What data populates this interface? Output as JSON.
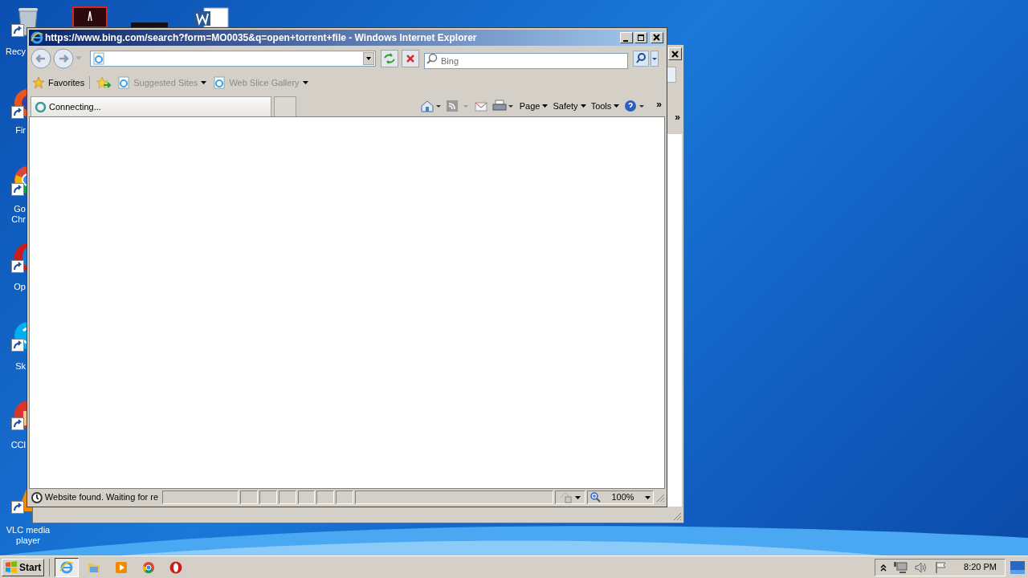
{
  "desktop_icons": [
    {
      "kind": "recycle",
      "lines": [
        "Recy"
      ]
    },
    {
      "kind": "firefox",
      "lines": [
        "Fir"
      ]
    },
    {
      "kind": "chrome",
      "lines": [
        "Go",
        "Chr"
      ]
    },
    {
      "kind": "opera",
      "lines": [
        "Op"
      ]
    },
    {
      "kind": "skype",
      "lines": [
        "Sk"
      ]
    },
    {
      "kind": "ccleaner",
      "lines": [
        "CCl"
      ]
    },
    {
      "kind": "vlc",
      "lines": [
        "VLC media",
        "player"
      ]
    }
  ],
  "back_window": {
    "chevron": "»"
  },
  "ie_window": {
    "title": "https://www.bing.com/search?form=MO0035&q=open+torrent+file - Windows Internet Explorer",
    "search": {
      "placeholder": "Bing"
    },
    "favorites_bar": [
      {
        "kind": "favorites",
        "label": "Favorites"
      },
      {
        "kind": "link",
        "label": "Suggested Sites"
      },
      {
        "kind": "link",
        "label": "Web Slice Gallery"
      }
    ],
    "tab": {
      "label": "Connecting..."
    },
    "command_bar": [
      "Page",
      "Safety",
      "Tools"
    ],
    "chevron": "»",
    "status_bar": {
      "text": "Website found. Waiting for re",
      "zoom": "100%"
    }
  },
  "taskbar": {
    "start": "Start",
    "items": [
      {
        "kind": "ie",
        "selected": true
      },
      {
        "kind": "folder",
        "selected": false
      },
      {
        "kind": "media",
        "selected": false
      },
      {
        "kind": "chrome",
        "selected": false
      },
      {
        "kind": "opera",
        "selected": false
      }
    ],
    "clock": "8:20 PM"
  }
}
